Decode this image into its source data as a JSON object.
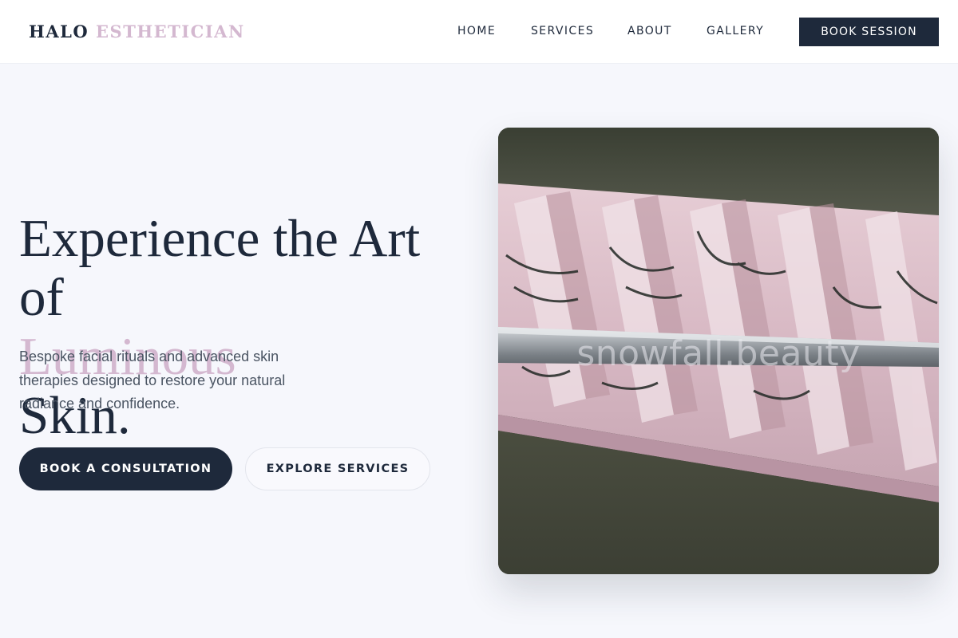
{
  "header": {
    "logo_primary": "HALO",
    "logo_accent": "ESTHETICIAN",
    "nav": [
      {
        "label": "HOME"
      },
      {
        "label": "SERVICES"
      },
      {
        "label": "ABOUT"
      },
      {
        "label": "GALLERY"
      }
    ],
    "cta_label": "BOOK SESSION"
  },
  "hero": {
    "headline_line1": "Experience the Art",
    "headline_line2_before": "of",
    "headline_line2_accent": "Luminous",
    "headline_line2_after": "Skin.",
    "subtitle": "Bespoke facial rituals and advanced skin therapies designed to restore your natural radiance and confidence.",
    "primary_button": "BOOK A CONSULTATION",
    "secondary_button": "EXPLORE SERVICES",
    "image_watermark": "snowfall.beauty"
  },
  "colors": {
    "navy": "#1e293b",
    "accent_lilac": "#d4b8d0",
    "background": "#f6f7fc"
  }
}
